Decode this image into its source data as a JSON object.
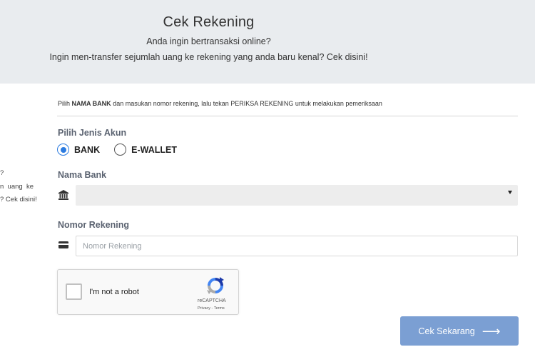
{
  "hero": {
    "title": "Cek Rekening",
    "subtitle1": "Anda ingin bertransaksi online?",
    "subtitle2": "Ingin men-transfer sejumlah uang ke rekening yang anda baru kenal? Cek disini!"
  },
  "side_fragments": [
    "?",
    "n  uang  ke",
    "? Cek disini!"
  ],
  "instruction": {
    "prefix": "Pilih ",
    "bold": "NAMA BANK",
    "suffix": " dan masukan nomor rekening, lalu tekan PERIKSA REKENING untuk melakukan pemeriksaan"
  },
  "account_type": {
    "label": "Pilih Jenis Akun",
    "options": [
      {
        "label": "BANK",
        "selected": true
      },
      {
        "label": "E-WALLET",
        "selected": false
      }
    ]
  },
  "bank": {
    "label": "Nama Bank",
    "icon": "bank-icon",
    "selected_value": ""
  },
  "account_number": {
    "label": "Nomor Rekening",
    "icon": "credit-card-icon",
    "placeholder": "Nomor Rekening",
    "value": ""
  },
  "recaptcha": {
    "label": "I'm not a robot",
    "brand": "reCAPTCHA",
    "links": "Privacy - Terms"
  },
  "submit": {
    "label": "Cek Sekarang",
    "icon": "long-arrow-right-icon"
  },
  "colors": {
    "hero_bg": "#e9ecef",
    "accent": "#2b7be0",
    "button_bg": "#7b9fd3",
    "label_color": "#5a6270"
  }
}
